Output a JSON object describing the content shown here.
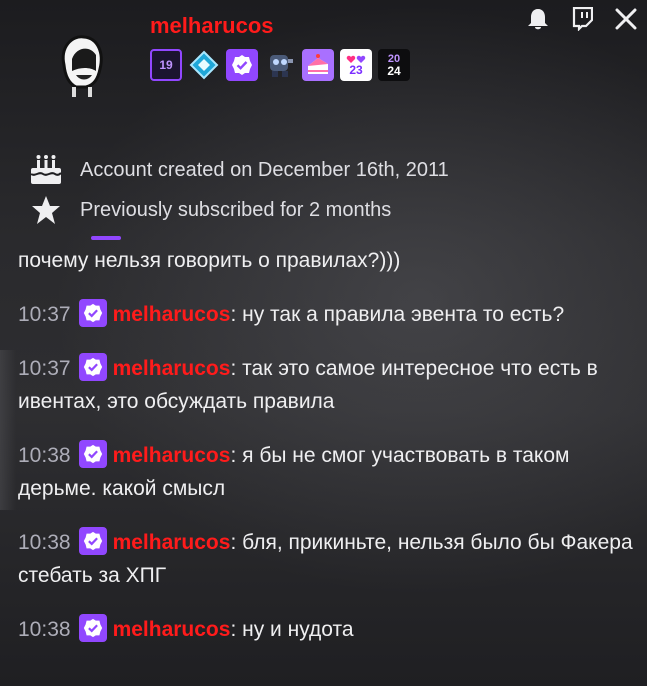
{
  "profile": {
    "username": "melharucos",
    "badges": [
      {
        "name": "subscriber-19-badge",
        "text": "19"
      },
      {
        "name": "prime-diamond-badge",
        "text": ""
      },
      {
        "name": "verified-badge",
        "text": ""
      },
      {
        "name": "robot-badge",
        "text": ""
      },
      {
        "name": "cake-badge",
        "text": ""
      },
      {
        "name": "hearts-2023-badge",
        "text": "23"
      },
      {
        "name": "year-2024-badge",
        "text": "24"
      }
    ],
    "account_created": "Account created on December 16th, 2011",
    "previously_subscribed": "Previously subscribed for 2 months"
  },
  "header_icons": [
    "bell-icon",
    "twitch-icon",
    "close-icon"
  ],
  "chat": {
    "partial_line": "почему нельзя говорить о правилах?)))",
    "messages": [
      {
        "time": "10:37",
        "user": "melharucos",
        "text": ": ну так а правила эвента то есть?"
      },
      {
        "time": "10:37",
        "user": "melharucos",
        "text": ": так это самое интересное что есть в ивентах, это обсуждать правила"
      },
      {
        "time": "10:38",
        "user": "melharucos",
        "text": ": я бы не смог участвовать в таком дерьме. какой смысл"
      },
      {
        "time": "10:38",
        "user": "melharucos",
        "text": ": бля, прикиньте, нельзя было бы Факера стебать за ХПГ"
      },
      {
        "time": "10:38",
        "user": "melharucos",
        "text": ": ну и нудота"
      }
    ]
  },
  "colors": {
    "username": "#ff1b1b",
    "accent": "#9147ff",
    "timestamp": "#adadb8"
  }
}
